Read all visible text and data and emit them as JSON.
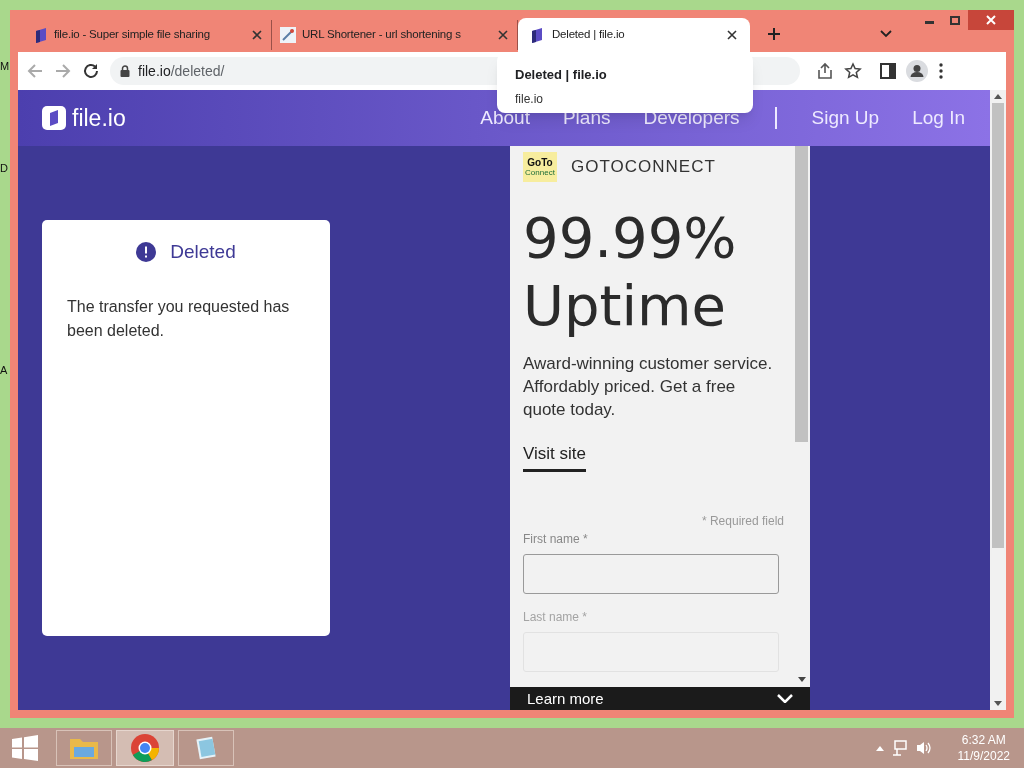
{
  "desktop_labels": [
    "M",
    "D",
    "A"
  ],
  "tabs": [
    {
      "title": "file.io - Super simple file sharing",
      "kind": "site",
      "selected": false
    },
    {
      "title": "URL Shortener - url shortening s",
      "kind": "link",
      "selected": false
    },
    {
      "title": "Deleted | file.io",
      "kind": "site",
      "selected": true
    }
  ],
  "address_bar": {
    "host": "file.io",
    "path": "/deleted/"
  },
  "tab_tooltip": {
    "title": "Deleted | file.io",
    "host": "file.io"
  },
  "site": {
    "logo": "file.io",
    "nav": [
      "About",
      "Plans",
      "Developers"
    ],
    "auth": [
      "Sign Up",
      "Log In"
    ]
  },
  "notice": {
    "title": "Deleted",
    "message": "The transfer you requested has been deleted."
  },
  "ad": {
    "logo_top": "GoTo",
    "logo_bottom": "Connect",
    "brand": "GOTOCONNECT",
    "headline": "99.99% Uptime",
    "body": "Award-winning customer service. Affordably priced. Get a free quote today.",
    "link": "Visit site",
    "required_note": "* Required field",
    "fields": [
      {
        "label": "First name *",
        "dimmed": false
      },
      {
        "label": "Last name *",
        "dimmed": true
      }
    ],
    "banner": "Learn more"
  },
  "taskbar": {
    "time": "6:32 AM",
    "date": "11/9/2022"
  }
}
